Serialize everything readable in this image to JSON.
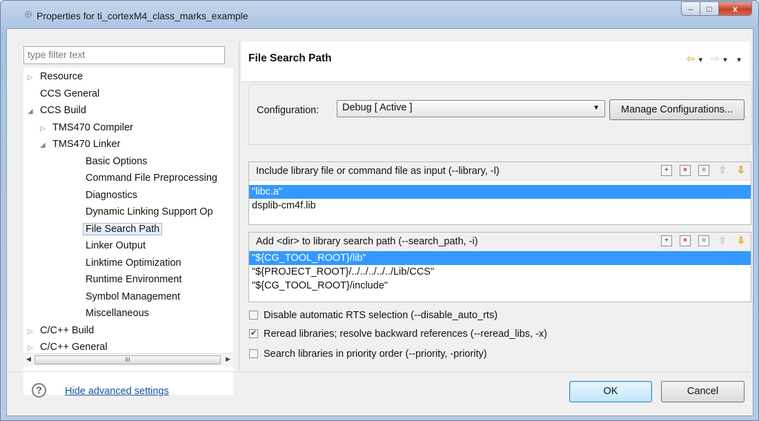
{
  "window": {
    "title": "Properties for ti_cortexM4_class_marks_example",
    "controls": {
      "minimize": "–",
      "maximize": "□",
      "close": "x"
    }
  },
  "filter": {
    "placeholder": "type filter text"
  },
  "tree": {
    "items": [
      {
        "label": "Resource",
        "twisty": "▷",
        "level": 0
      },
      {
        "label": "CCS General",
        "twisty": "",
        "level": 0
      },
      {
        "label": "CCS Build",
        "twisty": "◢",
        "level": 0
      },
      {
        "label": "TMS470 Compiler",
        "twisty": "▷",
        "level": 1
      },
      {
        "label": "TMS470 Linker",
        "twisty": "◢",
        "level": 1
      },
      {
        "label": "Basic Options",
        "twisty": "",
        "level": 2
      },
      {
        "label": "Command File Preprocessing",
        "twisty": "",
        "level": 2
      },
      {
        "label": "Diagnostics",
        "twisty": "",
        "level": 2
      },
      {
        "label": "Dynamic Linking Support Op",
        "twisty": "",
        "level": 2
      },
      {
        "label": "File Search Path",
        "twisty": "",
        "level": 2,
        "selected": true
      },
      {
        "label": "Linker Output",
        "twisty": "",
        "level": 2
      },
      {
        "label": "Linktime Optimization",
        "twisty": "",
        "level": 2
      },
      {
        "label": "Runtime Environment",
        "twisty": "",
        "level": 2
      },
      {
        "label": "Symbol Management",
        "twisty": "",
        "level": 2
      },
      {
        "label": "Miscellaneous",
        "twisty": "",
        "level": 2
      },
      {
        "label": "C/C++ Build",
        "twisty": "▷",
        "level": 0
      },
      {
        "label": "C/C++ General",
        "twisty": "▷",
        "level": 0
      }
    ],
    "scroll_thumb_grip": "III"
  },
  "page": {
    "title": "File Search Path",
    "nav": {
      "back": "⇦",
      "forward": "⇨",
      "dropdown": "▼",
      "menu": "▼"
    }
  },
  "configuration": {
    "label": "Configuration:",
    "value": "Debug  [ Active ]",
    "manage_label": "Manage Configurations..."
  },
  "library_group": {
    "label": "Include library file or command file as input (--library, -l)",
    "items": [
      "\"libc.a\"",
      "dsplib-cm4f.lib"
    ],
    "selected_index": 0,
    "tool_icons": [
      "add-icon",
      "delete-icon",
      "edit-icon",
      "move-up-icon",
      "move-down-icon"
    ]
  },
  "search_path_group": {
    "label": "Add <dir> to library search path (--search_path, -i)",
    "items": [
      "\"${CG_TOOL_ROOT}/lib\"",
      "\"${PROJECT_ROOT}/../../../../../Lib/CCS\"",
      "\"${CG_TOOL_ROOT}/include\""
    ],
    "selected_index": 0,
    "tool_icons": [
      "add-icon",
      "delete-icon",
      "edit-icon",
      "move-up-icon",
      "move-down-icon"
    ]
  },
  "options": [
    {
      "label": "Disable automatic RTS selection (--disable_auto_rts)",
      "checked": false
    },
    {
      "label": "Reread libraries; resolve backward references (--reread_libs, -x)",
      "checked": true
    },
    {
      "label": "Search libraries in priority order (--priority, -priority)",
      "checked": false
    }
  ],
  "footer": {
    "help_icon": "?",
    "hide_advanced_label": "Hide advanced settings",
    "ok_label": "OK",
    "cancel_label": "Cancel"
  },
  "colors": {
    "selection": "#3399ff",
    "link": "#1a4fa0",
    "accent_arrow": "#d2a500"
  }
}
